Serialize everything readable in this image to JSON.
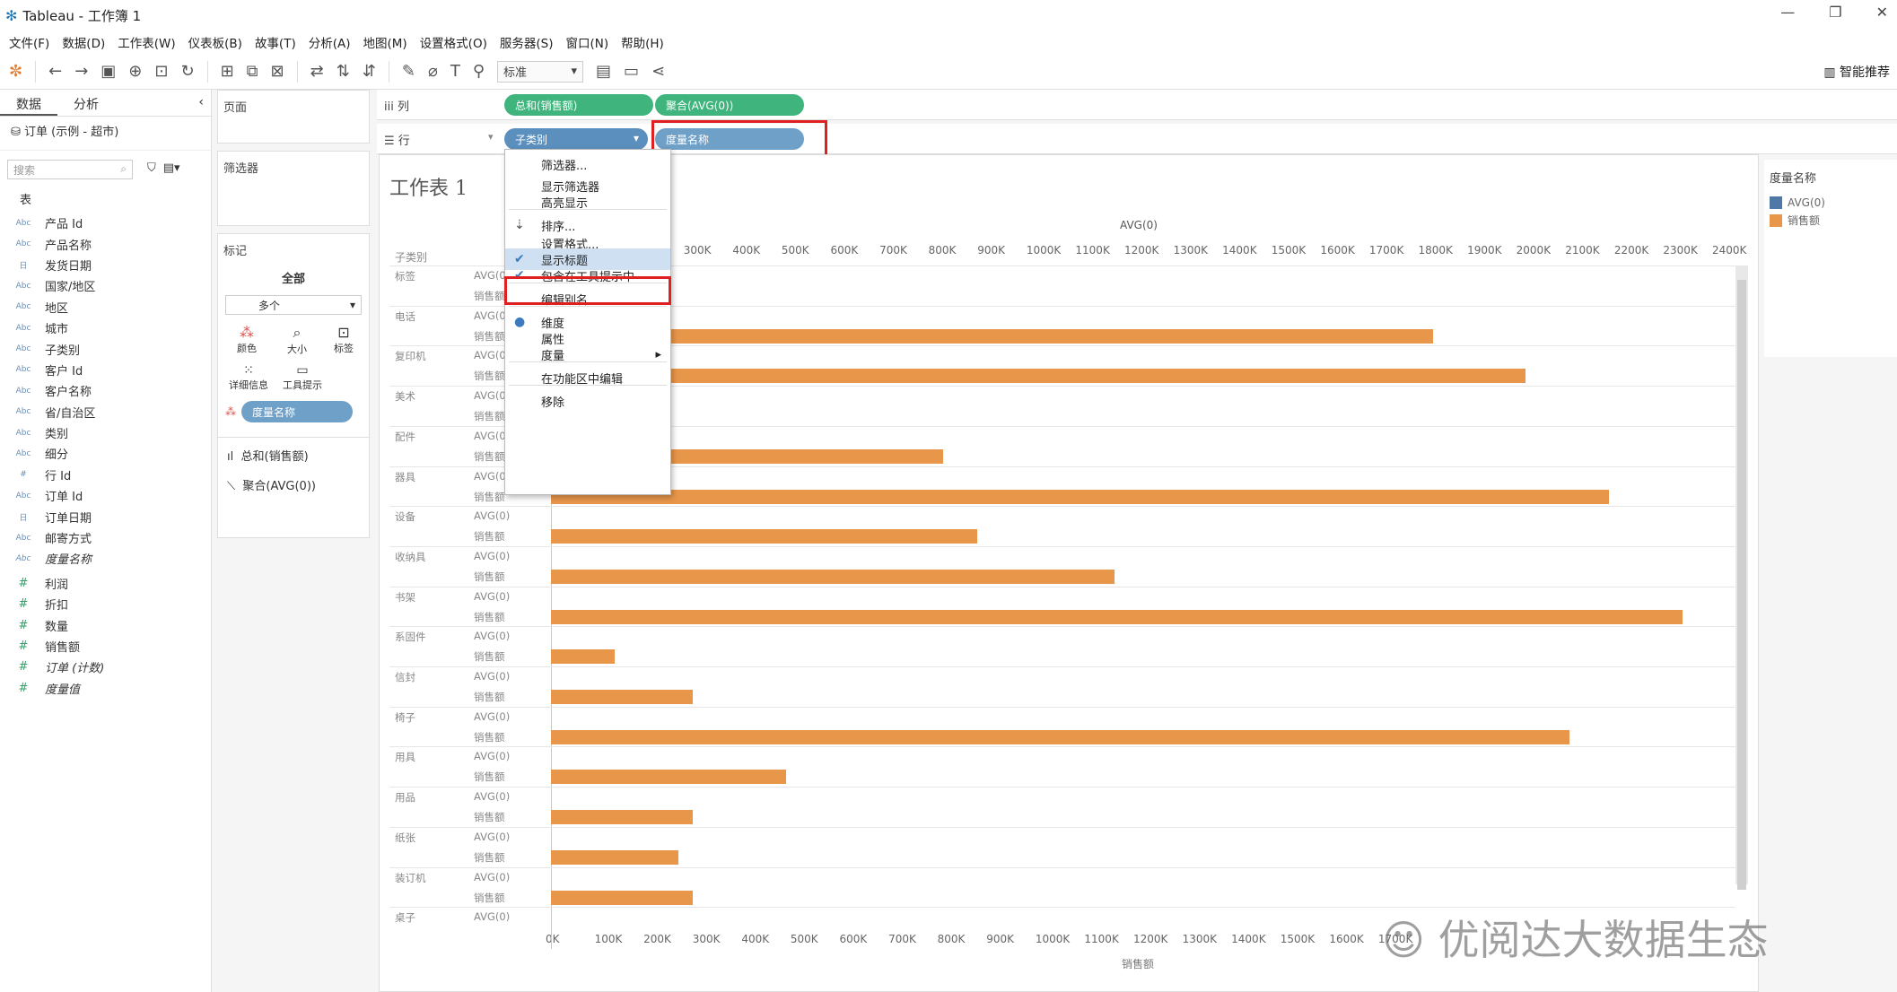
{
  "window": {
    "title": "Tableau - 工作簿 1"
  },
  "menu": [
    "文件(F)",
    "数据(D)",
    "工作表(W)",
    "仪表板(B)",
    "故事(T)",
    "分析(A)",
    "地图(M)",
    "设置格式(O)",
    "服务器(S)",
    "窗口(N)",
    "帮助(H)"
  ],
  "toolbar": {
    "fit_select": "标准",
    "smart_label": "智能推荐"
  },
  "data_pane": {
    "tabs": [
      "数据",
      "分析"
    ],
    "source": "订单 (示例 - 超市)",
    "search_placeholder": "搜索",
    "section": "表",
    "dimensions": [
      {
        "type": "Abc",
        "name": "产品 Id"
      },
      {
        "type": "Abc",
        "name": "产品名称"
      },
      {
        "type": "日",
        "name": "发货日期"
      },
      {
        "type": "Abc",
        "name": "国家/地区"
      },
      {
        "type": "Abc",
        "name": "地区"
      },
      {
        "type": "Abc",
        "name": "城市"
      },
      {
        "type": "Abc",
        "name": "子类别"
      },
      {
        "type": "Abc",
        "name": "客户 Id"
      },
      {
        "type": "Abc",
        "name": "客户名称"
      },
      {
        "type": "Abc",
        "name": "省/自治区"
      },
      {
        "type": "Abc",
        "name": "类别"
      },
      {
        "type": "Abc",
        "name": "细分"
      },
      {
        "type": "#",
        "name": "行 Id"
      },
      {
        "type": "Abc",
        "name": "订单 Id"
      },
      {
        "type": "日",
        "name": "订单日期"
      },
      {
        "type": "Abc",
        "name": "邮寄方式"
      },
      {
        "type": "Abc",
        "name": "度量名称"
      }
    ],
    "measures": [
      {
        "type": "#",
        "name": "利润"
      },
      {
        "type": "#",
        "name": "折扣"
      },
      {
        "type": "#",
        "name": "数量"
      },
      {
        "type": "#",
        "name": "销售额"
      },
      {
        "type": "#",
        "name": "订单 (计数)"
      },
      {
        "type": "#",
        "name": "度量值"
      }
    ]
  },
  "cards": {
    "pages": "页面",
    "filters": "筛选器",
    "marks": "标记",
    "marks_all": "全部",
    "marks_type": "多个",
    "mark_buttons": [
      "颜色",
      "大小",
      "标签",
      "详细信息",
      "工具提示"
    ],
    "color_pill": "度量名称",
    "marks_items": [
      "总和(销售额)",
      "聚合(AVG(0))"
    ]
  },
  "shelves": {
    "columns_label": "列",
    "rows_label": "行",
    "columns_pills": [
      "总和(销售额)",
      "聚合(AVG(0))"
    ],
    "rows_pills": [
      "子类别",
      "度量名称"
    ]
  },
  "context_menu": {
    "items": [
      {
        "label": "筛选器...",
        "checked": false
      },
      {
        "label": "显示筛选器",
        "checked": false
      },
      {
        "label": "高亮显示",
        "checked": false
      },
      {
        "label": "排序...",
        "checked": false
      },
      {
        "label": "设置格式...",
        "checked": false
      },
      {
        "label": "显示标题",
        "checked": true
      },
      {
        "label": "包含在工具提示中",
        "checked": true
      },
      {
        "label": "编辑别名...",
        "checked": false
      },
      {
        "label": "维度",
        "checked": true
      },
      {
        "label": "属性",
        "checked": false
      },
      {
        "label": "度量",
        "checked": false
      },
      {
        "label": "在功能区中编辑",
        "checked": false
      },
      {
        "label": "移除",
        "checked": false
      }
    ]
  },
  "view": {
    "sheet_title": "工作表 1",
    "row_header": "子类别",
    "top_axis_title": "AVG(0)",
    "bottom_axis_title": "销售额"
  },
  "legend": {
    "title": "度量名称",
    "items": [
      {
        "name": "AVG(0)",
        "color": "#4e79a7"
      },
      {
        "name": "销售额",
        "color": "#e8964a"
      }
    ]
  },
  "chart_data": {
    "type": "bar",
    "categories": [
      "标签",
      "电话",
      "复印机",
      "美术",
      "配件",
      "器具",
      "设备",
      "收纳具",
      "书架",
      "系固件",
      "信封",
      "椅子",
      "用具",
      "用品",
      "纸张",
      "装订机",
      "桌子"
    ],
    "series": [
      {
        "name": "AVG(0)",
        "values": [
          0,
          0,
          0,
          0,
          0,
          0,
          0,
          0,
          0,
          0,
          0,
          0,
          0,
          0,
          0,
          0,
          0
        ]
      },
      {
        "name": "销售额",
        "values": [
          null,
          1800000,
          1990000,
          null,
          800000,
          2160000,
          870000,
          1150000,
          2310000,
          130000,
          290000,
          2080000,
          480000,
          290000,
          260000,
          290000,
          null
        ]
      }
    ],
    "xlabel": "销售额",
    "xlim": [
      0,
      2400000
    ],
    "ticks": [
      "0K",
      "100K",
      "200K",
      "300K",
      "400K",
      "500K",
      "600K",
      "700K",
      "800K",
      "900K",
      "1000K",
      "1100K",
      "1200K",
      "1300K",
      "1400K",
      "1500K",
      "1600K",
      "1700K",
      "1800K",
      "1900K",
      "2000K",
      "2100K",
      "2200K",
      "2300K",
      "2400K"
    ]
  },
  "watermark": "优阅达大数据生态",
  "colors": {
    "bar": "#e8964a",
    "pill_green": "#3fb47c",
    "pill_blue": "#5b8fbd",
    "highlight": "#e02020"
  }
}
